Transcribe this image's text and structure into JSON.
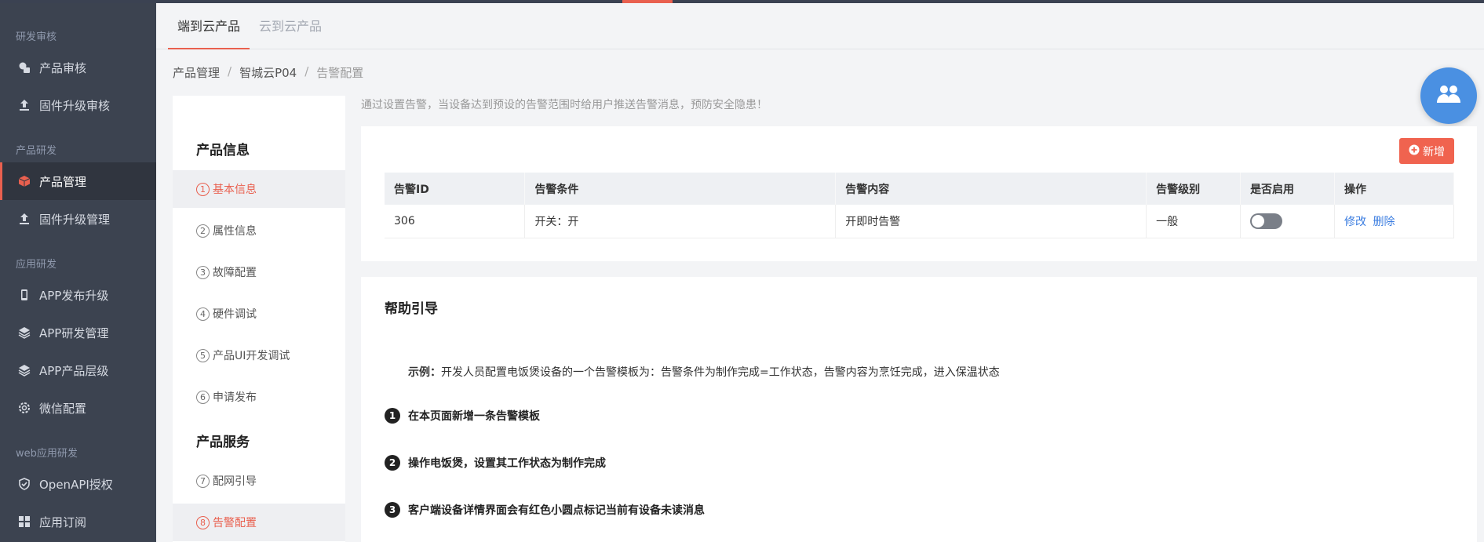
{
  "colors": {
    "accent": "#e9604f",
    "sidebar_bg": "#3c4350",
    "link": "#3b7de0",
    "fab": "#4a90e2"
  },
  "sidebar": {
    "sections": [
      {
        "title": "研发审核",
        "items": [
          {
            "label": "产品审核",
            "icon": "product-review-icon"
          },
          {
            "label": "固件升级审核",
            "icon": "upload-icon"
          }
        ]
      },
      {
        "title": "产品研发",
        "items": [
          {
            "label": "产品管理",
            "icon": "cube-icon",
            "active": true
          },
          {
            "label": "固件升级管理",
            "icon": "upload-icon"
          }
        ]
      },
      {
        "title": "应用研发",
        "items": [
          {
            "label": "APP发布升级",
            "icon": "phone-icon"
          },
          {
            "label": "APP研发管理",
            "icon": "layers-icon"
          },
          {
            "label": "APP产品层级",
            "icon": "layers-icon"
          },
          {
            "label": "微信配置",
            "icon": "gear-icon"
          }
        ]
      },
      {
        "title": "web应用研发",
        "items": [
          {
            "label": "OpenAPI授权",
            "icon": "shield-icon"
          },
          {
            "label": "应用订阅",
            "icon": "grid-icon"
          }
        ]
      }
    ]
  },
  "tabs": [
    {
      "label": "端到云产品",
      "active": true
    },
    {
      "label": "云到云产品"
    }
  ],
  "breadcrumb": {
    "items": [
      "产品管理",
      "智城云P04",
      "告警配置"
    ],
    "separator": "/"
  },
  "fab_icon": "users-icon",
  "steps": {
    "groups": [
      "产品信息",
      "产品服务"
    ],
    "items": [
      {
        "num": "1",
        "label": "基本信息",
        "active": true
      },
      {
        "num": "2",
        "label": "属性信息"
      },
      {
        "num": "3",
        "label": "故障配置"
      },
      {
        "num": "4",
        "label": "硬件调试"
      },
      {
        "num": "5",
        "label": "产品UI开发调试"
      },
      {
        "num": "6",
        "label": "申请发布"
      },
      {
        "num": "7",
        "label": "配网引导"
      },
      {
        "num": "8",
        "label": "告警配置",
        "active": true
      }
    ]
  },
  "tip": "通过设置告警，当设备达到预设的告警范围时给用户推送告警消息，预防安全隐患！",
  "alarm": {
    "add_label": "新增",
    "columns": [
      "告警ID",
      "告警条件",
      "告警内容",
      "告警级别",
      "是否启用",
      "操作"
    ],
    "rows": [
      {
        "id": "306",
        "condition": "开关：开",
        "content": "开即时告警",
        "level": "一般",
        "enabled": false,
        "edit": "修改",
        "delete": "删除"
      }
    ]
  },
  "help": {
    "title": "帮助引导",
    "example_label": "示例：",
    "example_text": "开发人员配置电饭煲设备的一个告警模板为：告警条件为制作完成=工作状态，告警内容为烹饪完成，进入保温状态",
    "steps": [
      {
        "num": "1",
        "text": "在本页面新增一条告警模板"
      },
      {
        "num": "2",
        "text": "操作电饭煲，设置其工作状态为制作完成"
      },
      {
        "num": "3",
        "text": "客户端设备详情界面会有红色小圆点标记当前有设备未读消息"
      }
    ]
  }
}
